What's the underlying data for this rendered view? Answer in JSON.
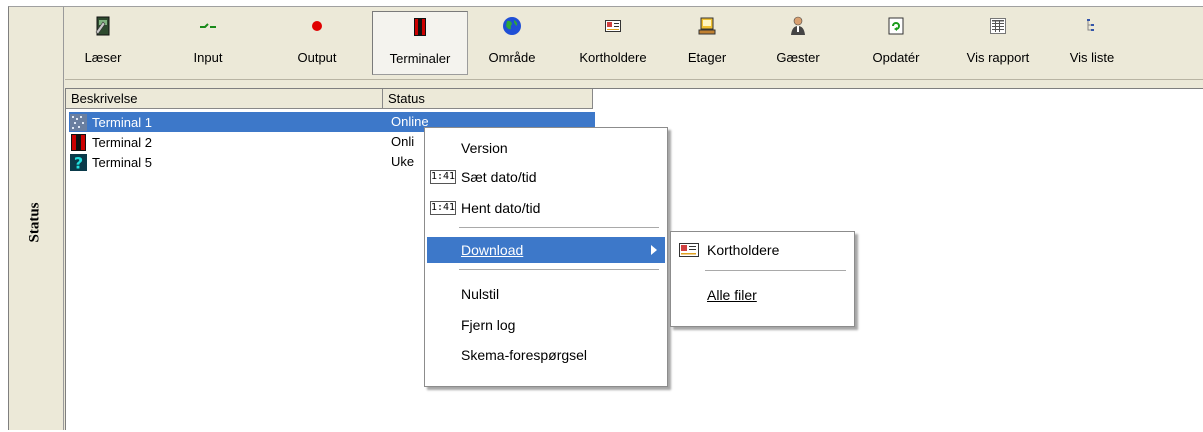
{
  "side_label": "Status",
  "toolbar": [
    {
      "label": "Læser",
      "icon": "reader-icon"
    },
    {
      "label": "Input",
      "icon": "input-icon"
    },
    {
      "label": "Output",
      "icon": "output-icon"
    },
    {
      "label": "Terminaler",
      "icon": "terminal-icon",
      "active": true
    },
    {
      "label": "Område",
      "icon": "globe-icon"
    },
    {
      "label": "Kortholdere",
      "icon": "card-icon"
    },
    {
      "label": "Etager",
      "icon": "floor-icon"
    },
    {
      "label": "Gæster",
      "icon": "guest-icon"
    },
    {
      "label": "Opdatér",
      "icon": "refresh-icon"
    },
    {
      "label": "Vis rapport",
      "icon": "report-icon"
    },
    {
      "label": "Vis liste",
      "icon": "list-icon"
    }
  ],
  "list": {
    "columns": [
      "Beskrivelse",
      "Status"
    ],
    "rows": [
      {
        "name": "Terminal 1",
        "status": "Online",
        "selected": true
      },
      {
        "name": "Terminal 2",
        "status": "Onli"
      },
      {
        "name": "Terminal 5",
        "status": "Uke"
      }
    ]
  },
  "context_menu": {
    "items": [
      {
        "label": "Version"
      },
      {
        "label": "Sæt dato/tid",
        "icon_text": "1:41"
      },
      {
        "label": "Hent dato/tid",
        "icon_text": "1:41"
      },
      {
        "label": "Download",
        "submenu": true,
        "highlighted": true
      },
      {
        "label": "Nulstil"
      },
      {
        "label": "Fjern log"
      },
      {
        "label": "Skema-forespørgsel"
      }
    ]
  },
  "submenu": {
    "items": [
      {
        "label": "Kortholdere",
        "icon": "card-icon"
      },
      {
        "label": "Alle filer"
      }
    ]
  },
  "colors": {
    "highlight": "#3d78c9",
    "face": "#ece9d8"
  }
}
